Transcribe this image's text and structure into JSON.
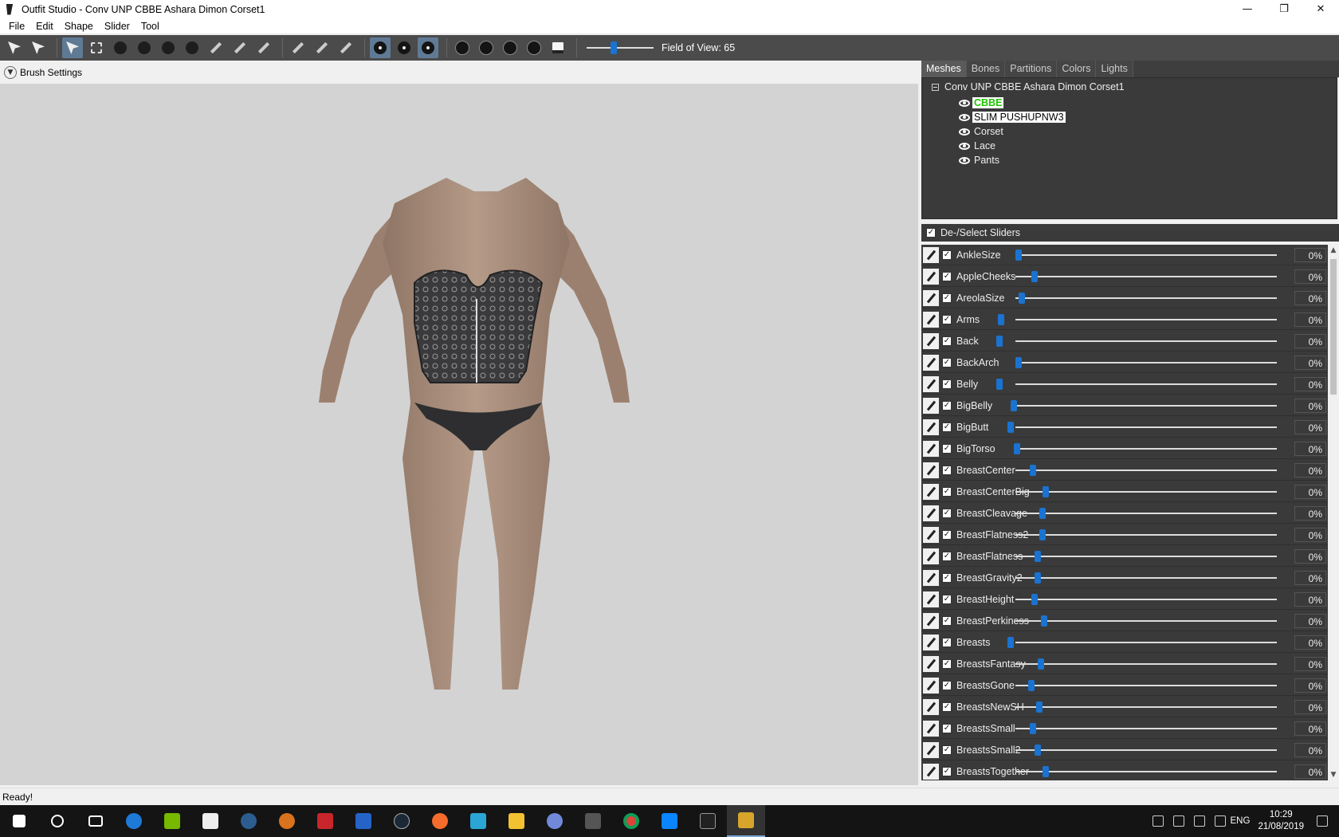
{
  "window": {
    "title": "Outfit Studio - Conv UNP CBBE Ashara Dimon Corset1",
    "controls": {
      "minimize": "—",
      "restore": "❐",
      "close": "✕"
    }
  },
  "menu": [
    "File",
    "Edit",
    "Shape",
    "Slider",
    "Tool"
  ],
  "toolbar": {
    "fov_label": "Field of View: 65",
    "fov_value": 65
  },
  "brush_settings_label": "Brush Settings",
  "tabs": [
    {
      "label": "Meshes",
      "active": true
    },
    {
      "label": "Bones",
      "active": false
    },
    {
      "label": "Partitions",
      "active": false
    },
    {
      "label": "Colors",
      "active": false
    },
    {
      "label": "Lights",
      "active": false
    }
  ],
  "mesh_tree": {
    "root": "Conv UNP CBBE Ashara Dimon Corset1",
    "items": [
      {
        "label": "CBBE",
        "state": "green"
      },
      {
        "label": "SLIM PUSHUPNW3",
        "state": "white"
      },
      {
        "label": "Corset",
        "state": "normal"
      },
      {
        "label": "Lace",
        "state": "normal"
      },
      {
        "label": "Pants",
        "state": "normal"
      }
    ]
  },
  "deselect_label": "De-/Select Sliders",
  "sliders": [
    {
      "name": "AnkleSize",
      "value": "0%"
    },
    {
      "name": "AppleCheeks",
      "value": "0%"
    },
    {
      "name": "AreolaSize",
      "value": "0%"
    },
    {
      "name": "Arms",
      "value": "0%"
    },
    {
      "name": "Back",
      "value": "0%"
    },
    {
      "name": "BackArch",
      "value": "0%"
    },
    {
      "name": "Belly",
      "value": "0%"
    },
    {
      "name": "BigBelly",
      "value": "0%"
    },
    {
      "name": "BigButt",
      "value": "0%"
    },
    {
      "name": "BigTorso",
      "value": "0%"
    },
    {
      "name": "BreastCenter",
      "value": "0%"
    },
    {
      "name": "BreastCenterBig",
      "value": "0%"
    },
    {
      "name": "BreastCleavage",
      "value": "0%"
    },
    {
      "name": "BreastFlatness2",
      "value": "0%"
    },
    {
      "name": "BreastFlatness",
      "value": "0%"
    },
    {
      "name": "BreastGravity2",
      "value": "0%"
    },
    {
      "name": "BreastHeight",
      "value": "0%"
    },
    {
      "name": "BreastPerkiness",
      "value": "0%"
    },
    {
      "name": "Breasts",
      "value": "0%"
    },
    {
      "name": "BreastsFantasy",
      "value": "0%"
    },
    {
      "name": "BreastsGone",
      "value": "0%"
    },
    {
      "name": "BreastsNewSH",
      "value": "0%"
    },
    {
      "name": "BreastsSmall",
      "value": "0%"
    },
    {
      "name": "BreastsSmall2",
      "value": "0%"
    },
    {
      "name": "BreastsTogether",
      "value": "0%"
    }
  ],
  "status": "Ready!",
  "taskbar": {
    "language": "ENG",
    "time": "10:29",
    "date": "21/08/2019"
  },
  "colors": {
    "viewport_bg": "#d3d3d3",
    "panel_bg": "#3a3a3a",
    "slider_thumb": "#1a73d0",
    "selected_mesh": "#1fc400"
  }
}
